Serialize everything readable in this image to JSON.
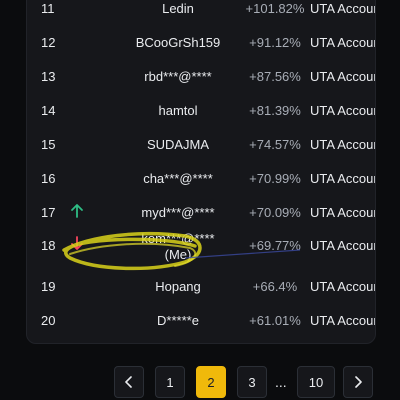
{
  "accent_color": "#f0b90b",
  "up_color": "#2ebd85",
  "down_color": "#f6465d",
  "rows": [
    {
      "rank": "11",
      "name": "Ledin",
      "roi": "+101.82%",
      "account": "UTA Accoun"
    },
    {
      "rank": "12",
      "name": "BCooGrSh159",
      "roi": "+91.12%",
      "account": "UTA Accoun"
    },
    {
      "rank": "13",
      "name": "rbd***@****",
      "roi": "+87.56%",
      "account": "UTA Accoun"
    },
    {
      "rank": "14",
      "name": "hamtol",
      "roi": "+81.39%",
      "account": "UTA Accoun"
    },
    {
      "rank": "15",
      "name": "SUDAJMA",
      "roi": "+74.57%",
      "account": "UTA Accoun"
    },
    {
      "rank": "16",
      "name": "cha***@****",
      "roi": "+70.99%",
      "account": "UTA Accoun"
    },
    {
      "rank": "17",
      "name": "myd***@****",
      "roi": "+70.09%",
      "account": "UTA Accoun",
      "trend_icon": "arrow-up-icon"
    },
    {
      "rank": "18",
      "name": "kom***@****",
      "name_suffix": "(Me)",
      "roi": "+69.77%",
      "account": "UTA Accoun",
      "trend_icon": "arrow-down-icon"
    },
    {
      "rank": "19",
      "name": "Hopang",
      "roi": "+66.4%",
      "account": "UTA Accoun"
    },
    {
      "rank": "20",
      "name": "D*****e",
      "roi": "+61.01%",
      "account": "UTA Accoun"
    }
  ],
  "pagination": {
    "prev_icon": "chevron-left-icon",
    "next_icon": "chevron-right-icon",
    "pages": [
      "1",
      "2",
      "3"
    ],
    "active_page": "2",
    "ellipsis": "...",
    "last_page": "10"
  }
}
